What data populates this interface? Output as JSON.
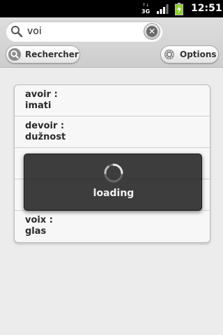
{
  "status_bar": {
    "network_type": "3G",
    "time": "12:51"
  },
  "search": {
    "query": "voi",
    "search_button_label": "Rechercher",
    "options_button_label": "Options"
  },
  "results": [
    {
      "term": "avoir :",
      "translation": "imati"
    },
    {
      "term": "devoir :",
      "translation": "dužnost"
    },
    {
      "term": "",
      "translation": ""
    },
    {
      "term": "",
      "translation": ""
    },
    {
      "term": "voix :",
      "translation": "glas"
    }
  ],
  "loading": {
    "label": "loading"
  },
  "colors": {
    "status_bar": "#000000",
    "background": "#ececec",
    "dialog": "#2d2d2d"
  }
}
